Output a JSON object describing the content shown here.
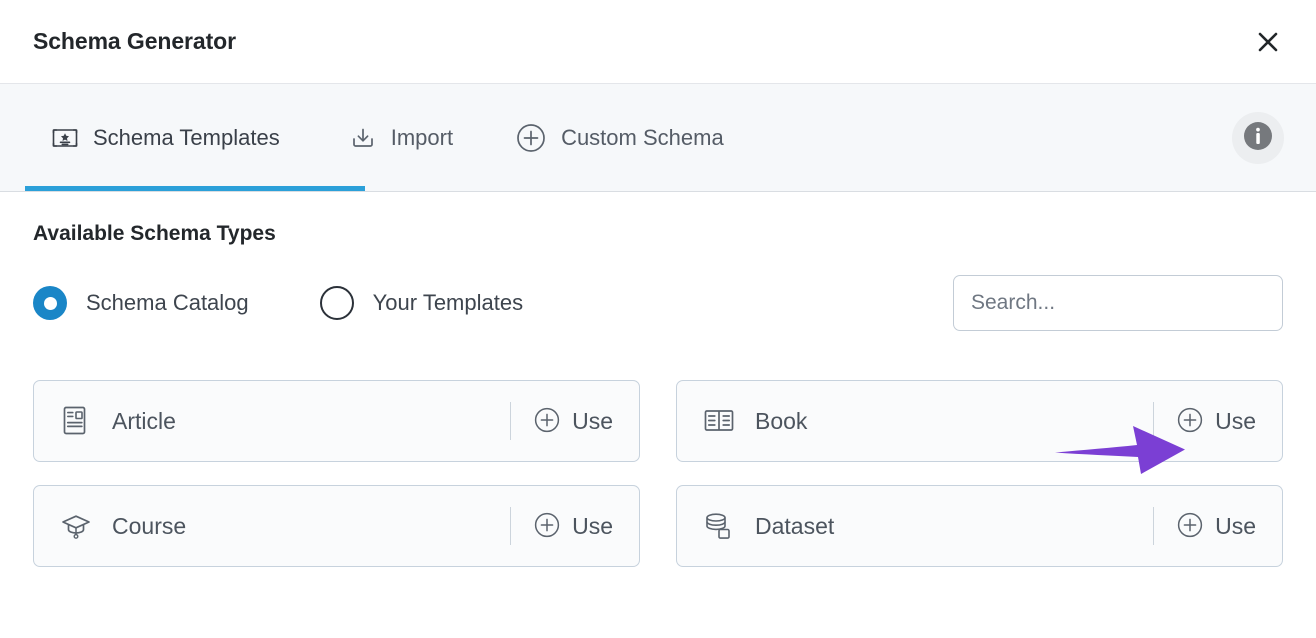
{
  "header": {
    "title": "Schema Generator",
    "close_icon": "close-icon"
  },
  "tabs": [
    {
      "id": "schema-templates",
      "label": "Schema Templates",
      "icon": "certificate-icon",
      "active": true
    },
    {
      "id": "import",
      "label": "Import",
      "icon": "download-tray-icon",
      "active": false
    },
    {
      "id": "custom-schema",
      "label": "Custom Schema",
      "icon": "plus-circle-icon",
      "active": false
    }
  ],
  "info_button": {
    "icon": "info-icon",
    "label": "i"
  },
  "main": {
    "section_title": "Available Schema Types",
    "radios": [
      {
        "id": "schema-catalog",
        "label": "Schema Catalog",
        "selected": true
      },
      {
        "id": "your-templates",
        "label": "Your Templates",
        "selected": false
      }
    ],
    "search": {
      "value": "",
      "placeholder": "Search..."
    },
    "use_label": "Use",
    "cards": [
      {
        "id": "article",
        "name": "Article",
        "icon": "article-document-icon"
      },
      {
        "id": "book",
        "name": "Book",
        "icon": "open-book-icon"
      },
      {
        "id": "course",
        "name": "Course",
        "icon": "graduation-cap-icon"
      },
      {
        "id": "dataset",
        "name": "Dataset",
        "icon": "database-stack-icon"
      }
    ]
  },
  "annotation": {
    "arrow_icon": "purple-pointer-arrow",
    "arrow_color": "#7b3fd4",
    "points_at": "book-use-button"
  },
  "colors": {
    "accent_blue": "#2ba0d9",
    "radio_blue": "#1a86c7",
    "card_border": "#c7d2dd",
    "card_bg": "#fafbfc",
    "tabbar_bg": "#f6f8fa",
    "text_dark": "#23272b",
    "text_muted": "#4c545e",
    "annotation_purple": "#7b3fd4"
  }
}
